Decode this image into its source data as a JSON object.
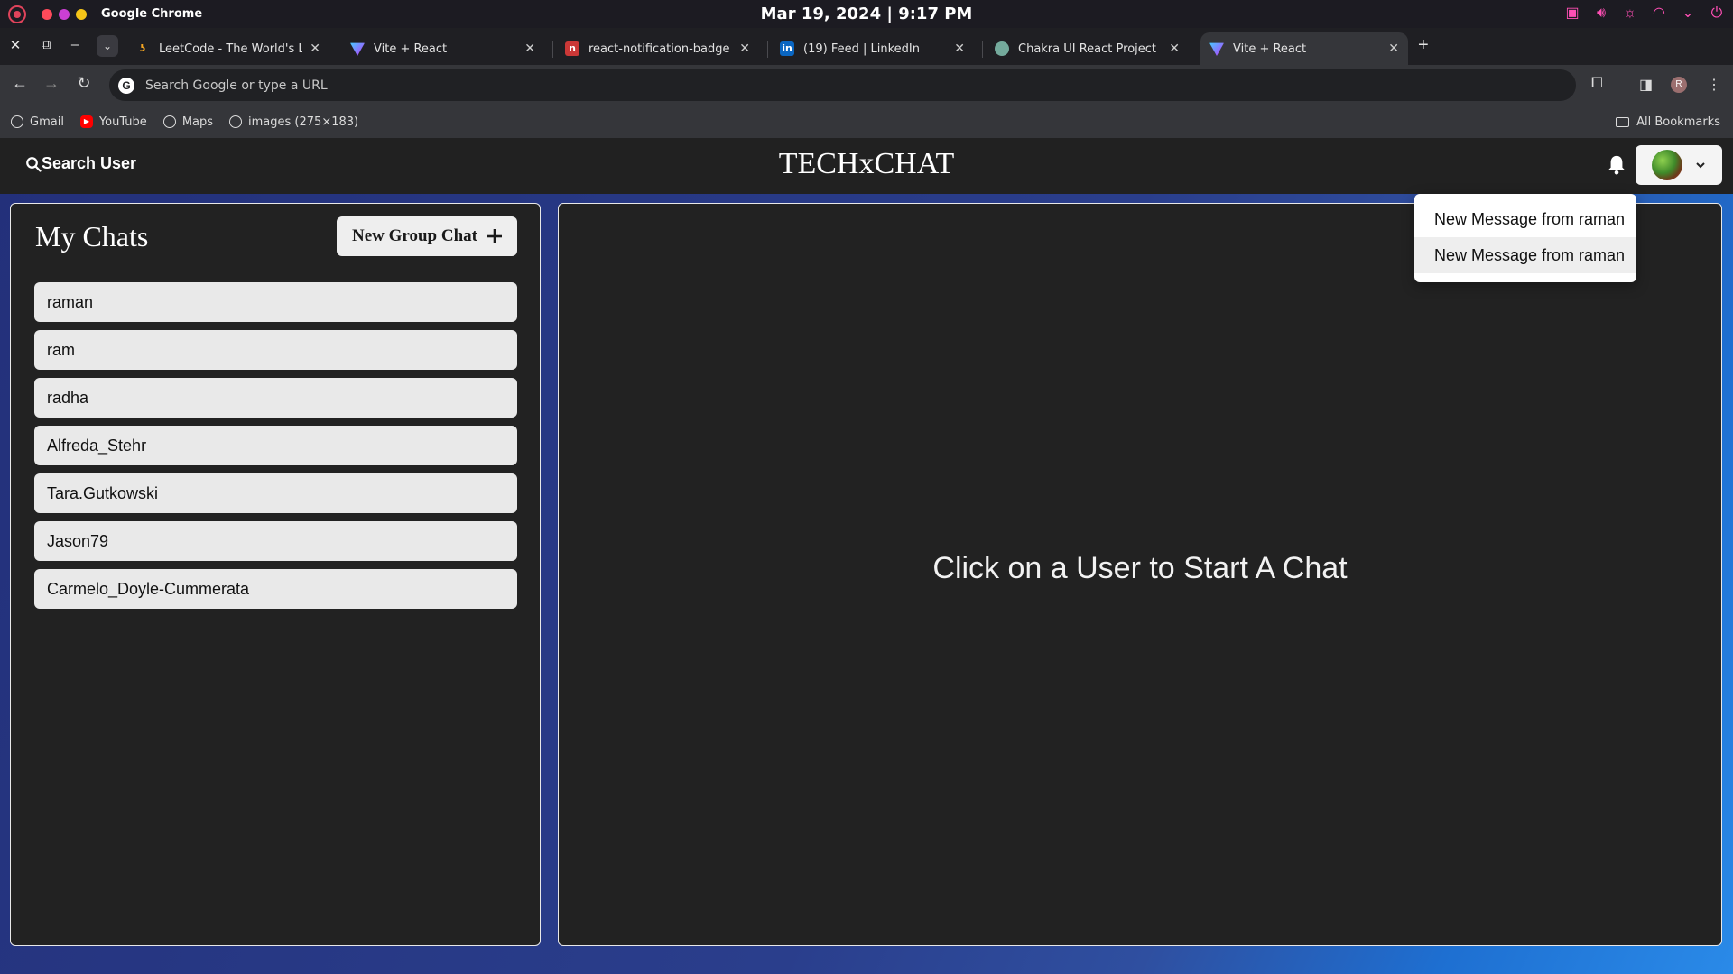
{
  "os": {
    "app_name": "Google Chrome",
    "clock": "Mar 19, 2024 | 9:17 PM",
    "dot_colors": [
      "#ff4a5a",
      "#cc3fd4",
      "#f5c518"
    ],
    "accent": "#ff4fb5"
  },
  "browser": {
    "tabs": [
      {
        "label": "LeetCode - The World's Leac",
        "icon": "leetcode-icon",
        "active": false
      },
      {
        "label": "Vite + React",
        "icon": "vite-icon",
        "active": false
      },
      {
        "label": "react-notification-badge - n",
        "icon": "npm-icon",
        "active": false
      },
      {
        "label": "(19) Feed | LinkedIn",
        "icon": "linkedin-icon",
        "active": false
      },
      {
        "label": "Chakra UI React Project",
        "icon": "chatgpt-icon",
        "active": false
      },
      {
        "label": "Vite + React",
        "icon": "vite-icon",
        "active": true
      }
    ],
    "omnibox_placeholder": "Search Google or type a URL",
    "profile_initial": "R",
    "bookmarks": [
      {
        "label": "Gmail",
        "icon": "globe-icon"
      },
      {
        "label": "YouTube",
        "icon": "youtube-icon"
      },
      {
        "label": "Maps",
        "icon": "globe-icon"
      },
      {
        "label": "images (275×183)",
        "icon": "globe-icon"
      }
    ],
    "all_bookmarks": "All Bookmarks"
  },
  "app": {
    "search_label": "Search User",
    "brand": "TECHxCHAT",
    "left": {
      "title": "My Chats",
      "new_group_label": "New Group Chat",
      "chats": [
        "raman",
        "ram",
        "radha",
        "Alfreda_Stehr",
        "Tara.Gutkowski",
        "Jason79",
        "Carmelo_Doyle-Cummerata"
      ]
    },
    "right": {
      "empty_message": "Click on a User to Start A Chat"
    },
    "notifications": [
      "New Message from raman",
      "New Message from raman"
    ]
  }
}
